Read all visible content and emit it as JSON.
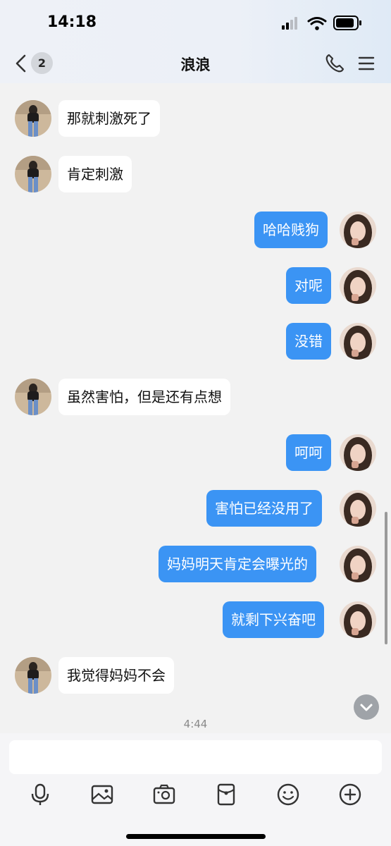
{
  "status_bar": {
    "time": "14:18"
  },
  "header": {
    "title": "浪浪",
    "unread_count": "2"
  },
  "messages": [
    {
      "side": "incoming",
      "text": "那就刺激死了"
    },
    {
      "side": "incoming",
      "text": "肯定刺激"
    },
    {
      "side": "outgoing",
      "text": "哈哈贱狗"
    },
    {
      "side": "outgoing",
      "text": "对呢"
    },
    {
      "side": "outgoing",
      "text": "没错"
    },
    {
      "side": "incoming",
      "text": "虽然害怕，但是还有点想"
    },
    {
      "side": "outgoing",
      "text": "呵呵"
    },
    {
      "side": "outgoing",
      "text": "害怕已经没用了"
    },
    {
      "side": "outgoing",
      "text": "妈妈明天肯定会曝光的"
    },
    {
      "side": "outgoing",
      "text": "就剩下兴奋吧"
    },
    {
      "side": "incoming",
      "text": "我觉得妈妈不会"
    }
  ],
  "timestamp_separator": "4:44",
  "composer": {
    "input_value": "",
    "toolbar_icons": [
      "microphone-icon",
      "image-icon",
      "camera-icon",
      "red-packet-icon",
      "emoji-icon",
      "plus-icon"
    ]
  },
  "colors": {
    "outgoing_bubble": "#3b94f4",
    "incoming_bubble": "#ffffff",
    "chat_background": "#f2f2f2"
  }
}
